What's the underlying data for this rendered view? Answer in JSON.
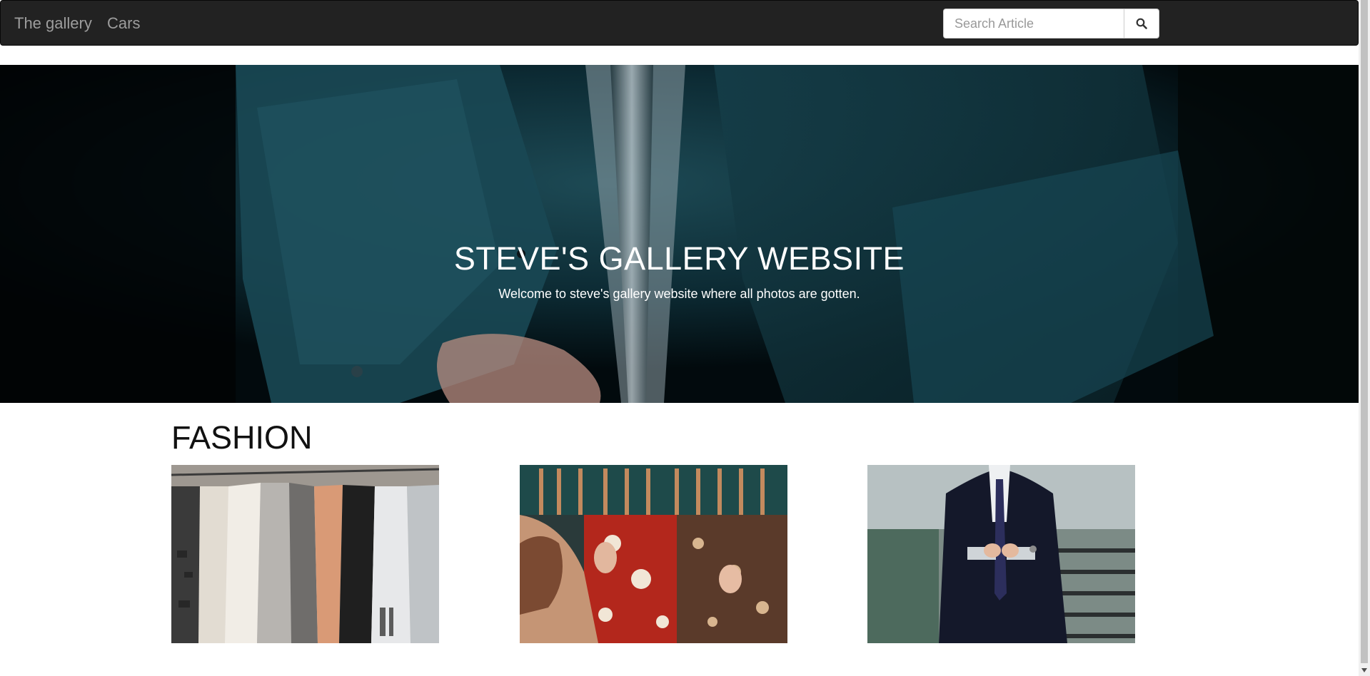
{
  "navbar": {
    "brand_label": "The gallery",
    "cars_label": "Cars",
    "search_placeholder": "Search Article",
    "search_icon": "search-icon"
  },
  "hero": {
    "title": "STEVE'S GALLERY WEBSITE",
    "subtitle": "Welcome to steve's gallery website where all photos are gotten."
  },
  "fashion": {
    "heading": "FASHION",
    "images": [
      {
        "name": "clothes-rack-photo"
      },
      {
        "name": "shopping-floral-shirts-photo"
      },
      {
        "name": "man-in-suit-photo"
      }
    ]
  },
  "colors": {
    "navbar_bg": "#222222",
    "nav_text": "#9d9d9d",
    "hero_text": "#ffffff"
  }
}
